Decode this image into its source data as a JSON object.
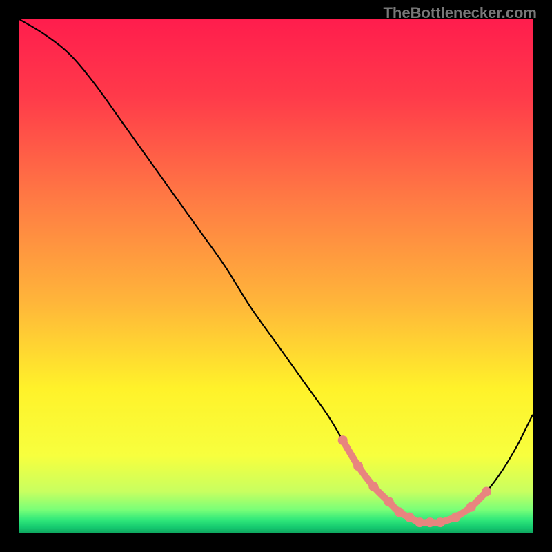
{
  "watermark": "TheBottlenecker.com",
  "chart_data": {
    "type": "line",
    "title": "",
    "xlabel": "",
    "ylabel": "",
    "xlim": [
      0,
      100
    ],
    "ylim": [
      0,
      100
    ],
    "x": [
      0,
      5,
      10,
      15,
      20,
      25,
      30,
      35,
      40,
      45,
      50,
      55,
      60,
      63,
      66,
      69,
      72,
      74,
      76,
      78,
      80,
      82,
      85,
      88,
      91,
      94,
      97,
      100
    ],
    "curve_y": [
      100,
      97,
      93,
      87,
      80,
      73,
      66,
      59,
      52,
      44,
      37,
      30,
      23,
      18,
      13,
      9,
      6,
      4,
      3,
      2,
      2,
      2,
      3,
      5,
      8,
      12,
      17,
      23
    ],
    "highlight_segments": [
      {
        "x": [
          63,
          66,
          69,
          72
        ],
        "y": [
          18,
          13,
          9,
          6
        ]
      },
      {
        "x": [
          72,
          74,
          76,
          78,
          80,
          82,
          85
        ],
        "y": [
          6,
          4,
          3,
          2,
          2,
          2,
          3
        ]
      },
      {
        "x": [
          85,
          88,
          91
        ],
        "y": [
          3,
          5,
          8
        ]
      }
    ],
    "gradient_stops": [
      {
        "offset": 0.0,
        "color": "#ff1d4d"
      },
      {
        "offset": 0.15,
        "color": "#ff3a4a"
      },
      {
        "offset": 0.35,
        "color": "#ff7a44"
      },
      {
        "offset": 0.55,
        "color": "#ffb53a"
      },
      {
        "offset": 0.72,
        "color": "#fff22a"
      },
      {
        "offset": 0.85,
        "color": "#f7ff3e"
      },
      {
        "offset": 0.92,
        "color": "#c8ff60"
      },
      {
        "offset": 0.955,
        "color": "#7aff78"
      },
      {
        "offset": 0.975,
        "color": "#30e87a"
      },
      {
        "offset": 0.99,
        "color": "#15c96f"
      },
      {
        "offset": 1.0,
        "color": "#0fa860"
      }
    ],
    "colors": {
      "curve": "#000000",
      "highlight": "#e8857f",
      "background_frame": "#000000"
    }
  }
}
